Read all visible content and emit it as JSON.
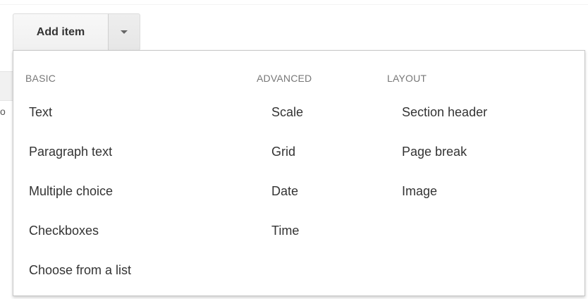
{
  "toolbar": {
    "add_item_label": "Add item",
    "dropdown_icon": "caret-down"
  },
  "menu": {
    "basic": {
      "header": "BASIC",
      "items": [
        "Text",
        "Paragraph text",
        "Multiple choice",
        "Checkboxes",
        "Choose from a list"
      ]
    },
    "advanced": {
      "header": "ADVANCED",
      "items": [
        "Scale",
        "Grid",
        "Date",
        "Time"
      ]
    },
    "layout": {
      "header": "LAYOUT",
      "items": [
        "Section header",
        "Page break",
        "Image"
      ]
    }
  },
  "background": {
    "partial_char": "o"
  }
}
